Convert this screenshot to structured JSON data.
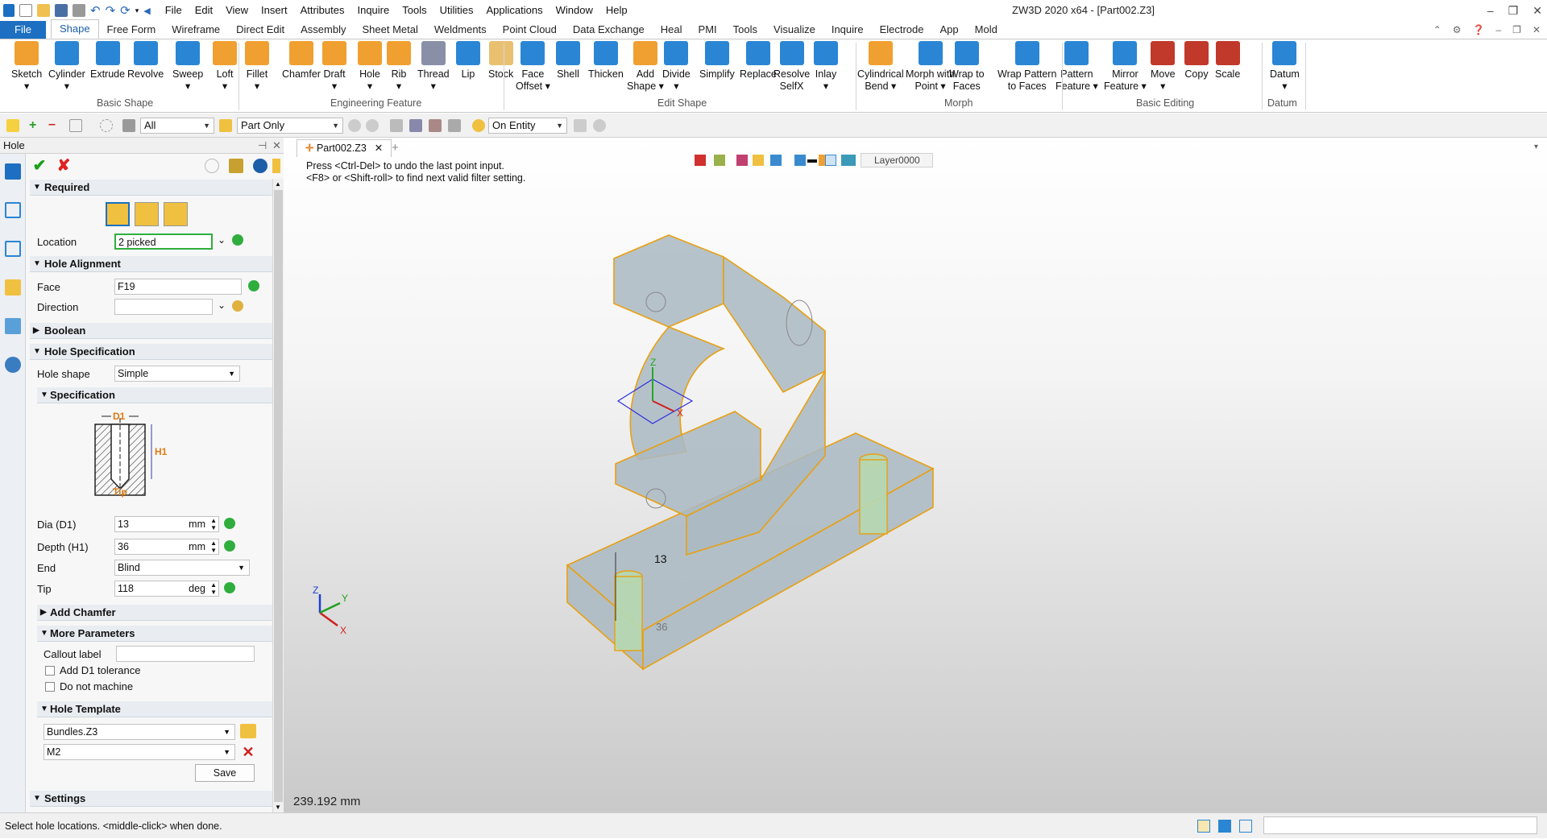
{
  "title_bar": {
    "menu": [
      "File",
      "Edit",
      "View",
      "Insert",
      "Attributes",
      "Inquire",
      "Tools",
      "Utilities",
      "Applications",
      "Window",
      "Help"
    ],
    "window_title": "ZW3D 2020 x64 - [Part002.Z3]"
  },
  "ribbon_tabs": [
    "File",
    "Shape",
    "Free Form",
    "Wireframe",
    "Direct Edit",
    "Assembly",
    "Sheet Metal",
    "Weldments",
    "Point Cloud",
    "Data Exchange",
    "Heal",
    "PMI",
    "Tools",
    "Visualize",
    "Inquire",
    "Electrode",
    "App",
    "Mold"
  ],
  "ribbon": {
    "buttons": [
      {
        "label": "Sketch",
        "sub": "▾",
        "color": "#f0a030"
      },
      {
        "label": "Cylinder",
        "sub": "▾",
        "color": "#2a86d4"
      },
      {
        "label": "Extrude",
        "sub": "",
        "color": "#2a86d4"
      },
      {
        "label": "Revolve",
        "sub": "",
        "color": "#2a86d4"
      },
      {
        "label": "Sweep",
        "sub": "▾",
        "color": "#2a86d4"
      },
      {
        "label": "Loft",
        "sub": "▾",
        "color": "#f0a030"
      },
      {
        "label": "Fillet",
        "sub": "▾",
        "color": "#f0a030"
      },
      {
        "label": "Chamfer",
        "sub": "",
        "color": "#f0a030"
      },
      {
        "label": "Draft",
        "sub": "▾",
        "color": "#f0a030"
      },
      {
        "label": "Hole",
        "sub": "▾",
        "color": "#f0a030"
      },
      {
        "label": "Rib",
        "sub": "▾",
        "color": "#f0a030"
      },
      {
        "label": "Thread",
        "sub": "▾",
        "color": "#8a8fa8"
      },
      {
        "label": "Lip",
        "sub": "",
        "color": "#2a86d4"
      },
      {
        "label": "Stock",
        "sub": "",
        "color": "#e8c070"
      },
      {
        "label": "Face",
        "sub": "Offset ▾",
        "color": "#2a86d4"
      },
      {
        "label": "Shell",
        "sub": "",
        "color": "#2a86d4"
      },
      {
        "label": "Thicken",
        "sub": "",
        "color": "#2a86d4"
      },
      {
        "label": "Add",
        "sub": "Shape ▾",
        "color": "#f0a030"
      },
      {
        "label": "Divide",
        "sub": "▾",
        "color": "#2a86d4"
      },
      {
        "label": "Simplify",
        "sub": "",
        "color": "#2a86d4"
      },
      {
        "label": "Replace",
        "sub": "",
        "color": "#2a86d4"
      },
      {
        "label": "Resolve",
        "sub": "SelfX",
        "color": "#2a86d4"
      },
      {
        "label": "Inlay",
        "sub": "▾",
        "color": "#2a86d4"
      },
      {
        "label": "Cylindrical",
        "sub": "Bend ▾",
        "color": "#f0a030"
      },
      {
        "label": "Morph with",
        "sub": "Point ▾",
        "color": "#2a86d4"
      },
      {
        "label": "Wrap to",
        "sub": "Faces",
        "color": "#2a86d4"
      },
      {
        "label": "Wrap Pattern",
        "sub": "to Faces",
        "color": "#2a86d4"
      },
      {
        "label": "Pattern",
        "sub": "Feature ▾",
        "color": "#2a86d4"
      },
      {
        "label": "Mirror",
        "sub": "Feature ▾",
        "color": "#2a86d4"
      },
      {
        "label": "Move",
        "sub": "▾",
        "color": "#c0392b"
      },
      {
        "label": "Copy",
        "sub": "",
        "color": "#c0392b"
      },
      {
        "label": "Scale",
        "sub": "",
        "color": "#c0392b"
      },
      {
        "label": "Datum",
        "sub": "▾",
        "color": "#2a86d4"
      }
    ],
    "groups": [
      "Basic Shape",
      "Engineering Feature",
      "Edit Shape",
      "Morph",
      "Basic Editing",
      "Datum"
    ]
  },
  "filter_bar": {
    "filter": "All",
    "scope": "Part Only",
    "pick": "On Entity"
  },
  "panel": {
    "title": "Hole",
    "sections": {
      "required": "Required",
      "alignment": "Hole Alignment",
      "boolean": "Boolean",
      "spec_header": "Hole Specification",
      "spec": "Specification",
      "chamfer": "Add Chamfer",
      "more": "More Parameters",
      "template": "Hole Template",
      "settings": "Settings"
    },
    "location_label": "Location",
    "location_value": "2 picked",
    "face_label": "Face",
    "face_value": "F19",
    "direction_label": "Direction",
    "direction_value": "",
    "shape_label": "Hole shape",
    "shape_value": "Simple",
    "diagram": {
      "d1": "D1",
      "h1": "H1",
      "tip": "Tip"
    },
    "dia_label": "Dia (D1)",
    "dia_value": "13",
    "dia_unit": "mm",
    "depth_label": "Depth (H1)",
    "depth_value": "36",
    "depth_unit": "mm",
    "end_label": "End",
    "end_value": "Blind",
    "tip_label": "Tip",
    "tip_value": "118",
    "tip_unit": "deg",
    "callout_label": "Callout label",
    "callout_value": "",
    "tolerance_label": "Add D1 tolerance",
    "nomachine_label": "Do not machine",
    "template_file": "Bundles.Z3",
    "template_size": "M2",
    "save_label": "Save"
  },
  "viewport": {
    "doc_tab": "Part002.Z3",
    "prompt_line1": "Press <Ctrl-Del> to undo the last point input.",
    "prompt_line2": "<F8> or <Shift-roll> to find next valid filter setting.",
    "layer": "Layer0000",
    "dim_13": "13",
    "dim_36": "36",
    "distance": "239.192 mm",
    "axis_x": "X",
    "axis_y": "Y",
    "axis_z": "Z"
  },
  "status": {
    "message": "Select hole locations. <middle-click> when done."
  }
}
